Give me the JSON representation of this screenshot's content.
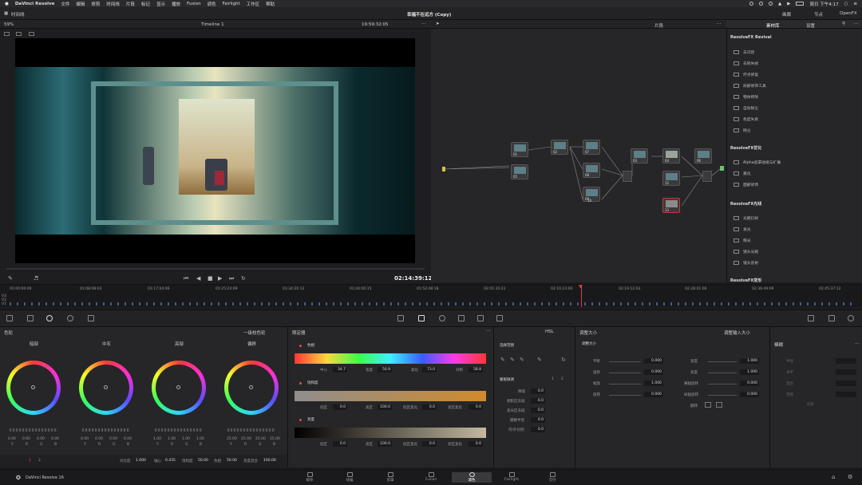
{
  "menubar": {
    "app": "DaVinci Resolve",
    "items": [
      "文件",
      "编辑",
      "修剪",
      "时间线",
      "片段",
      "标记",
      "显示",
      "播放",
      "Fusion",
      "调色",
      "Fairlight",
      "工作区",
      "帮助"
    ],
    "clock": "周日 下午4:17"
  },
  "titlebar": {
    "left_label": "时间线",
    "project": "幸福不在远方 (Copy)",
    "right_items": [
      "画廊",
      "节点",
      "OpenFX"
    ]
  },
  "viewer": {
    "zoom": "59%",
    "timeline_name": "Timeline 1",
    "source_tc": "19:59:32:05",
    "current_tc": "02:14:39:12"
  },
  "nodes": {
    "header_label": "片段",
    "labels": [
      "01",
      "02",
      "07",
      "08",
      "09",
      "10",
      "05",
      "03",
      "04",
      "12",
      "13",
      "06"
    ]
  },
  "fx": {
    "tabs": [
      "素材库",
      "设置"
    ],
    "sections": [
      {
        "title": "ResolveFX Revival",
        "items": [
          "去闪烁",
          "去除失帧",
          "坏点修复",
          "局部修饰工具",
          "物体移除",
          "自动除尘",
          "色度失真",
          "除尘"
        ]
      },
      {
        "title": "ResolveFX优化",
        "items": [
          "Alpha遮罩收缩与扩展",
          "美化",
          "面部修饰"
        ]
      },
      {
        "title": "ResolveFX光线",
        "items": [
          "光圈衍射",
          "发光",
          "辉光",
          "镜头光斑",
          "镜头反射"
        ]
      },
      {
        "title": "ResolveFX变形",
        "items": []
      }
    ]
  },
  "ruler": {
    "ticks": [
      "01:00:00:00",
      "01:08:08:03",
      "01:17:04:06",
      "01:25:24:09",
      "01:34:20:12",
      "01:44:00:15",
      "01:52:48:18",
      "02:01:35:21",
      "02:10:23:00",
      "02:19:12:03",
      "02:28:01:06",
      "02:36:49:09",
      "02:45:37:12"
    ],
    "tracks": [
      "V3",
      "V2",
      "V1"
    ]
  },
  "wheels": {
    "title": "色轮",
    "mode": "一级校色轮",
    "wheels": [
      {
        "label": "暗部",
        "values": [
          "0.00",
          "0.00",
          "0.00",
          "0.00"
        ]
      },
      {
        "label": "中灰",
        "values": [
          "0.00",
          "0.00",
          "0.00",
          "0.00"
        ]
      },
      {
        "label": "亮部",
        "values": [
          "1.00",
          "1.00",
          "1.00",
          "1.00"
        ]
      },
      {
        "label": "偏移",
        "values": [
          "25.00",
          "25.00",
          "25.00",
          "25.00"
        ]
      }
    ],
    "channels": [
      "Y",
      "R",
      "G",
      "B"
    ],
    "footer": {
      "pages": [
        "1",
        "2"
      ],
      "contrast_label": "对比度",
      "contrast": "1.000",
      "pivot_label": "轴心",
      "pivot": "0.435",
      "sat_label": "饱和度",
      "sat": "50.00",
      "hue_label": "色相",
      "hue": "50.00",
      "lummix_label": "亮度混合",
      "lummix": "100.00"
    }
  },
  "curves": {
    "title": "限定器",
    "hue": {
      "label": "色相",
      "center_label": "中心",
      "center": "34.7",
      "width_label": "宽度",
      "width": "50.9",
      "soft_label": "柔化",
      "soft": "73.0",
      "sym_label": "对称",
      "sym": "58.8"
    },
    "sat": {
      "label": "饱和度",
      "low_label": "低区",
      "low": "0.0",
      "high_label": "高区",
      "high": "100.0",
      "lsoft_label": "低区柔化",
      "lsoft": "0.0",
      "hsoft_label": "高区柔化",
      "hsoft": "0.0"
    },
    "lum": {
      "label": "亮度",
      "low_label": "低区",
      "low": "0.0",
      "high_label": "高区",
      "high": "100.0",
      "lsoft_label": "低区柔化",
      "lsoft": "0.0",
      "hsoft_label": "高区柔化",
      "hsoft": "0.0"
    }
  },
  "qualifier": {
    "mode": "HSL",
    "select_label": "选择范围",
    "matte_label": "蒙版微调",
    "pages": [
      "1",
      "2"
    ],
    "rows": [
      {
        "label": "降噪",
        "value": "0.0"
      },
      {
        "label": "阴影区去斑",
        "value": "0.0"
      },
      {
        "label": "高光区去斑",
        "value": "0.0"
      },
      {
        "label": "模糊半径",
        "value": "0.0"
      },
      {
        "label": "内/外比例",
        "value": "0.0"
      }
    ]
  },
  "sizing": {
    "title": "调整大小",
    "mode": "调整输入大小",
    "section": "调整大小",
    "left": [
      {
        "label": "平移",
        "value": "0.000"
      },
      {
        "label": "竖移",
        "value": "0.000"
      },
      {
        "label": "缩放",
        "value": "1.000"
      },
      {
        "label": "旋转",
        "value": "0.000"
      }
    ],
    "right": [
      {
        "label": "宽度",
        "value": "1.000"
      },
      {
        "label": "高度",
        "value": "1.000"
      },
      {
        "label": "横轴旋转",
        "value": "0.000"
      },
      {
        "label": "纵轴旋转",
        "value": "0.000"
      }
    ],
    "flip_label": "翻转"
  },
  "blur": {
    "title": "模糊",
    "rows": [
      "半径",
      "水平",
      "混合",
      "范围"
    ],
    "sync": "同步"
  },
  "pagebar": {
    "brand": "DaVinci Resolve 16",
    "pages": [
      "媒体",
      "快编",
      "剪辑",
      "Fusion",
      "调色",
      "Fairlight",
      "交付"
    ],
    "active": "调色"
  }
}
